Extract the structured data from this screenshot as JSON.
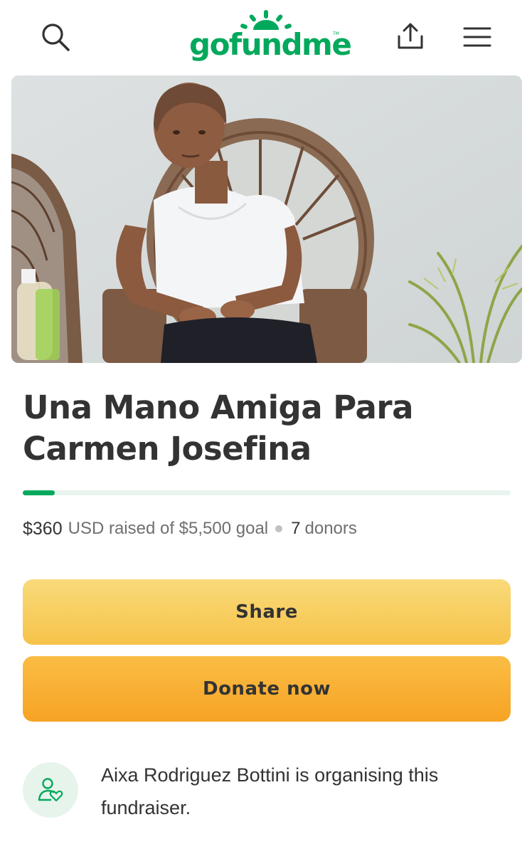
{
  "header": {
    "logo_text": "gofundme",
    "logo_tm": "TM",
    "icons": [
      "search-icon",
      "share-upload-icon",
      "menu-icon"
    ]
  },
  "colors": {
    "brand_green": "#02a95c",
    "share_button": "#f7cb5a",
    "donate_button": "#f8ad31",
    "progress_track": "#e8f4ee"
  },
  "campaign": {
    "title_line1": "Una Mano Amiga Para",
    "title_line2": "Carmen Josefina",
    "raised_amount": "$360",
    "raised_suffix": "USD raised of $5,500 goal",
    "donor_count": "7",
    "donor_label": "donors",
    "progress_fraction": 0.065
  },
  "actions": {
    "share_label": "Share",
    "donate_label": "Donate now"
  },
  "organiser": {
    "text": "Aixa Rodriguez Bottini is organising this fundraiser."
  }
}
